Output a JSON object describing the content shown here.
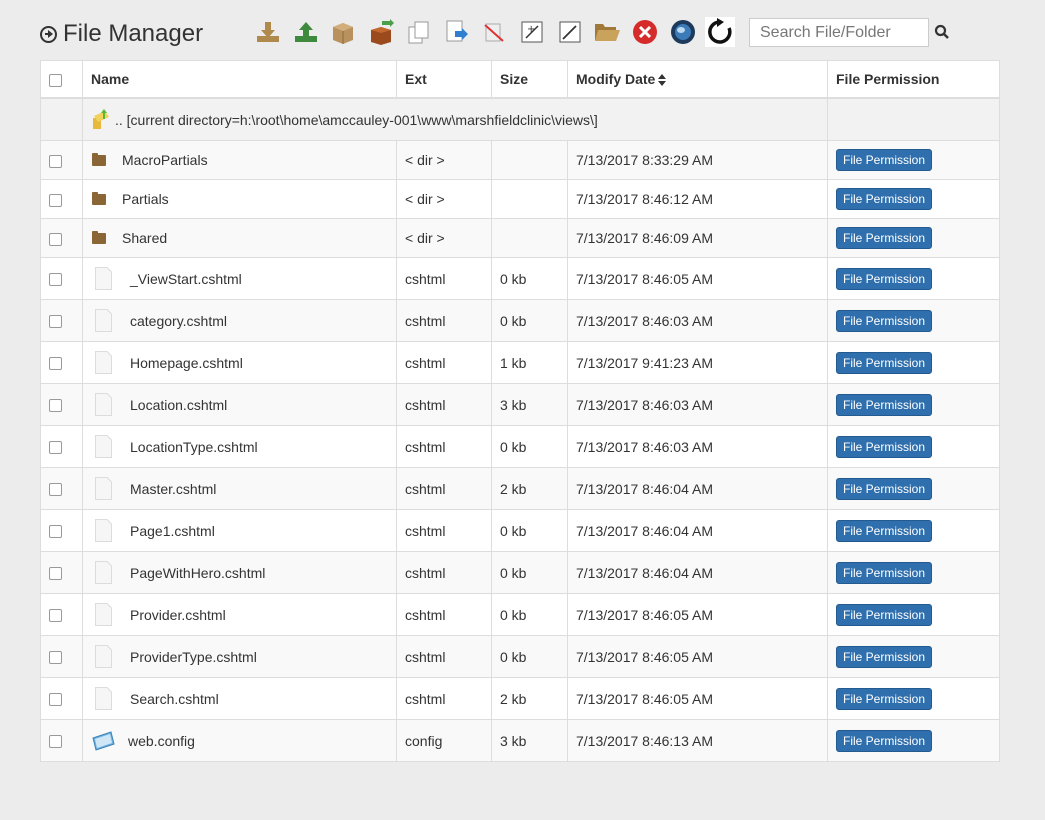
{
  "app": {
    "title": "File Manager"
  },
  "toolbar": {
    "icons": [
      "download-icon",
      "upload-icon",
      "archive-icon",
      "extract-icon",
      "copy-icon",
      "move-icon",
      "delete-file-icon",
      "new-file-icon",
      "edit-icon",
      "open-folder-icon",
      "cancel-icon",
      "globe-icon",
      "refresh-icon"
    ]
  },
  "search": {
    "placeholder": "Search File/Folder"
  },
  "table": {
    "headers": {
      "name": "Name",
      "ext": "Ext",
      "size": "Size",
      "date": "Modify Date",
      "perm": "File Permission"
    },
    "current_dir": ".. [current directory=h:\\root\\home\\amccauley-001\\www\\marshfieldclinic\\views\\]",
    "rows": [
      {
        "type": "folder",
        "name": "MacroPartials",
        "ext": "< dir >",
        "size": "",
        "date": "7/13/2017 8:33:29 AM",
        "perm": "File Permission"
      },
      {
        "type": "folder",
        "name": "Partials",
        "ext": "< dir >",
        "size": "",
        "date": "7/13/2017 8:46:12 AM",
        "perm": "File Permission"
      },
      {
        "type": "folder",
        "name": "Shared",
        "ext": "< dir >",
        "size": "",
        "date": "7/13/2017 8:46:09 AM",
        "perm": "File Permission"
      },
      {
        "type": "file",
        "name": "_ViewStart.cshtml",
        "ext": "cshtml",
        "size": "0 kb",
        "date": "7/13/2017 8:46:05 AM",
        "perm": "File Permission"
      },
      {
        "type": "file",
        "name": "category.cshtml",
        "ext": "cshtml",
        "size": "0 kb",
        "date": "7/13/2017 8:46:03 AM",
        "perm": "File Permission"
      },
      {
        "type": "file",
        "name": "Homepage.cshtml",
        "ext": "cshtml",
        "size": "1 kb",
        "date": "7/13/2017 9:41:23 AM",
        "perm": "File Permission"
      },
      {
        "type": "file",
        "name": "Location.cshtml",
        "ext": "cshtml",
        "size": "3 kb",
        "date": "7/13/2017 8:46:03 AM",
        "perm": "File Permission"
      },
      {
        "type": "file",
        "name": "LocationType.cshtml",
        "ext": "cshtml",
        "size": "0 kb",
        "date": "7/13/2017 8:46:03 AM",
        "perm": "File Permission"
      },
      {
        "type": "file",
        "name": "Master.cshtml",
        "ext": "cshtml",
        "size": "2 kb",
        "date": "7/13/2017 8:46:04 AM",
        "perm": "File Permission"
      },
      {
        "type": "file",
        "name": "Page1.cshtml",
        "ext": "cshtml",
        "size": "0 kb",
        "date": "7/13/2017 8:46:04 AM",
        "perm": "File Permission"
      },
      {
        "type": "file",
        "name": "PageWithHero.cshtml",
        "ext": "cshtml",
        "size": "0 kb",
        "date": "7/13/2017 8:46:04 AM",
        "perm": "File Permission"
      },
      {
        "type": "file",
        "name": "Provider.cshtml",
        "ext": "cshtml",
        "size": "0 kb",
        "date": "7/13/2017 8:46:05 AM",
        "perm": "File Permission"
      },
      {
        "type": "file",
        "name": "ProviderType.cshtml",
        "ext": "cshtml",
        "size": "0 kb",
        "date": "7/13/2017 8:46:05 AM",
        "perm": "File Permission"
      },
      {
        "type": "file",
        "name": "Search.cshtml",
        "ext": "cshtml",
        "size": "2 kb",
        "date": "7/13/2017 8:46:05 AM",
        "perm": "File Permission"
      },
      {
        "type": "config",
        "name": "web.config",
        "ext": "config",
        "size": "3 kb",
        "date": "7/13/2017 8:46:13 AM",
        "perm": "File Permission"
      }
    ]
  }
}
